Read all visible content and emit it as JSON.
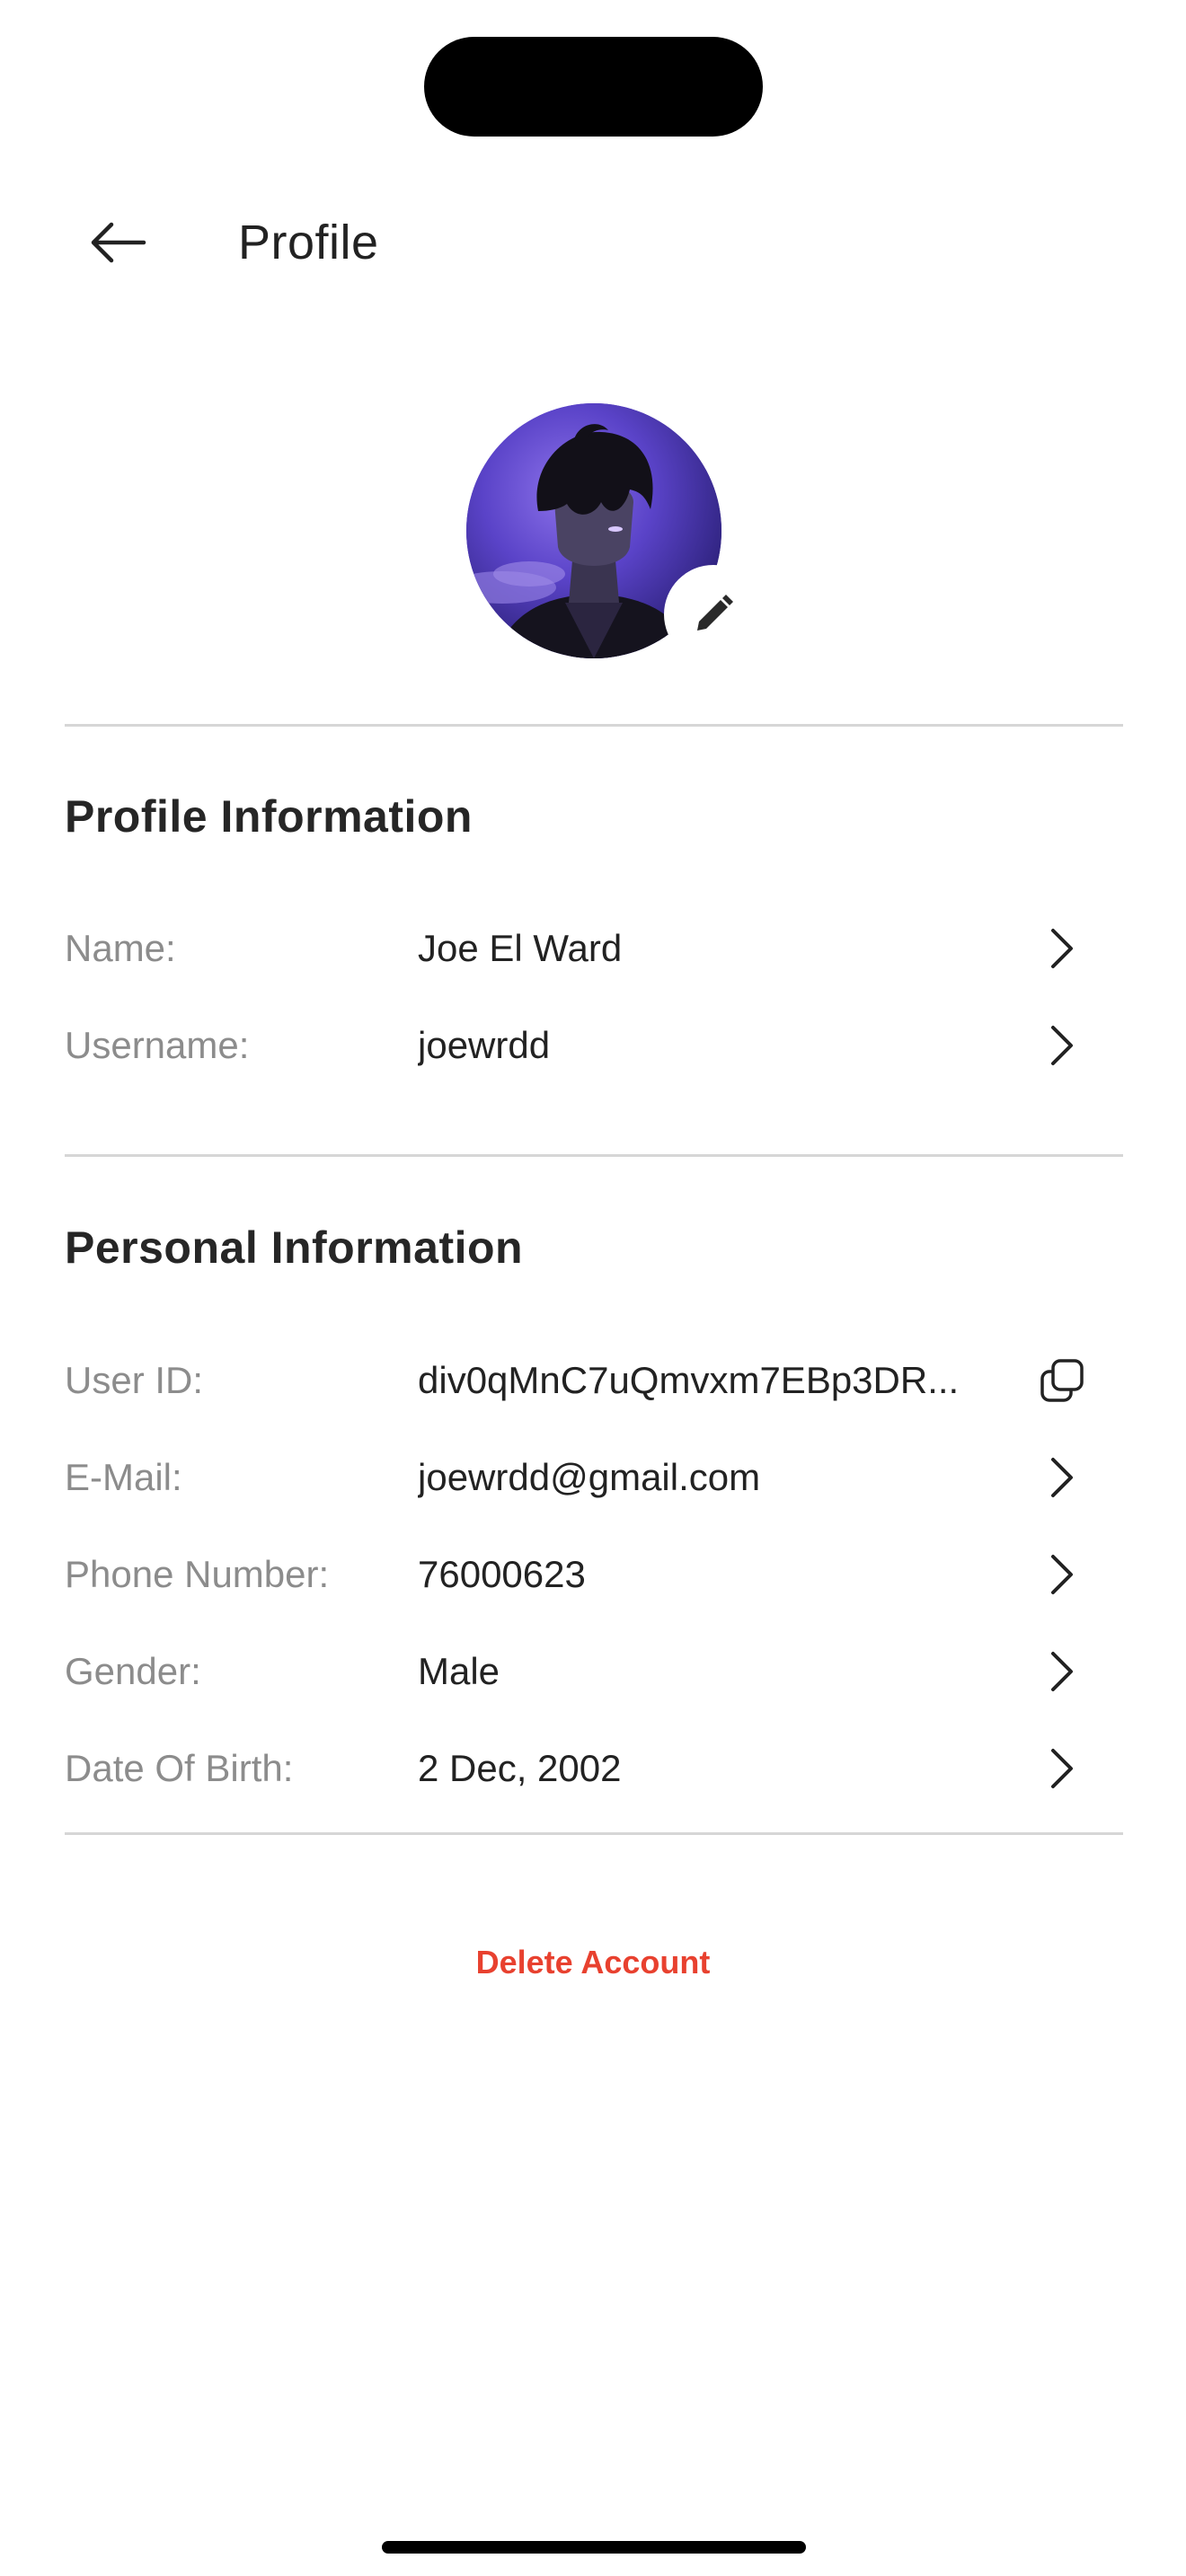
{
  "header": {
    "title": "Profile",
    "back_icon": "arrow-left-icon"
  },
  "avatar": {
    "edit_icon": "pencil-icon",
    "colors": [
      "#8a6ee6",
      "#5b44c9",
      "#2e2280"
    ]
  },
  "profile_section": {
    "title": "Profile Information",
    "rows": [
      {
        "label": "Name:",
        "value": "Joe El Ward",
        "icon": "chevron-right-icon"
      },
      {
        "label": "Username:",
        "value": "joewrdd",
        "icon": "chevron-right-icon"
      }
    ]
  },
  "personal_section": {
    "title": "Personal Information",
    "rows": [
      {
        "label": "User ID:",
        "value": "div0qMnC7uQmvxm7EBp3DR...",
        "icon": "copy-icon"
      },
      {
        "label": "E-Mail:",
        "value": "joewrdd@gmail.com",
        "icon": "chevron-right-icon"
      },
      {
        "label": "Phone Number:",
        "value": "76000623",
        "icon": "chevron-right-icon"
      },
      {
        "label": "Gender:",
        "value": "Male",
        "icon": "chevron-right-icon"
      },
      {
        "label": "Date Of Birth:",
        "value": "2 Dec, 2002",
        "icon": "chevron-right-icon"
      }
    ]
  },
  "actions": {
    "delete_label": "Delete Account",
    "delete_color": "#e8412f"
  }
}
